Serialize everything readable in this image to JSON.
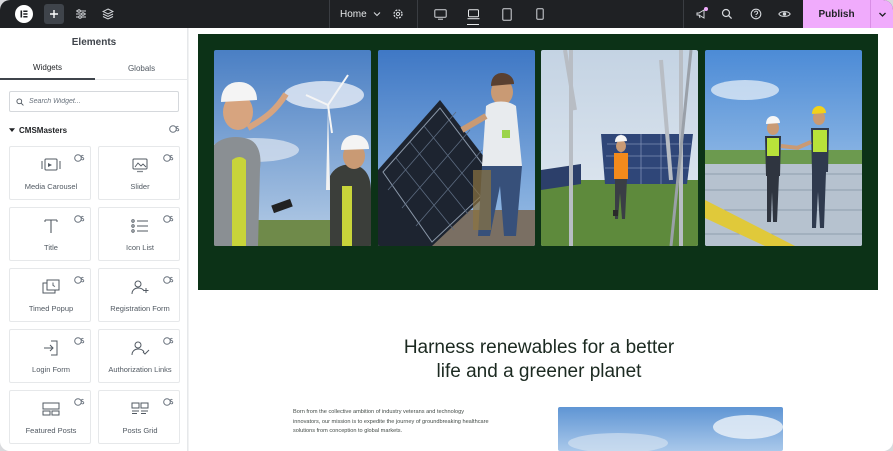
{
  "topbar": {
    "page_name": "Home",
    "publish_label": "Publish",
    "colors": {
      "bar": "#1f2124",
      "publish": "#f0abfc"
    }
  },
  "panel": {
    "title": "Elements",
    "tabs": [
      {
        "label": "Widgets",
        "active": true
      },
      {
        "label": "Globals",
        "active": false
      }
    ],
    "search_placeholder": "Search Widget...",
    "category": "CMSMasters",
    "widgets": [
      {
        "label": "Media Carousel",
        "icon": "media-carousel-icon"
      },
      {
        "label": "Slider",
        "icon": "slider-icon"
      },
      {
        "label": "Title",
        "icon": "title-icon"
      },
      {
        "label": "Icon List",
        "icon": "icon-list-icon"
      },
      {
        "label": "Timed Popup",
        "icon": "timed-popup-icon"
      },
      {
        "label": "Registration Form",
        "icon": "registration-form-icon"
      },
      {
        "label": "Login Form",
        "icon": "login-form-icon"
      },
      {
        "label": "Authorization Links",
        "icon": "authorization-links-icon"
      },
      {
        "label": "Featured Posts",
        "icon": "featured-posts-icon"
      },
      {
        "label": "Posts Grid",
        "icon": "posts-grid-icon"
      }
    ]
  },
  "canvas": {
    "hero_bg": "#0c3217",
    "photos": [
      "engineers-wind-turbine-photo",
      "worker-installing-solar-panel-photo",
      "worker-solar-field-photo",
      "engineers-rooftop-solar-photo"
    ],
    "heading_line1": "Harness renewables for a better",
    "heading_line2": "life and a greener planet",
    "paragraph_line1": "Born from the collective ambition of industry veterans and technology",
    "paragraph_line2": "innovators, our mission is to expedite the journey of groundbreaking healthcare",
    "paragraph_line3": "solutions from conception to global markets."
  }
}
